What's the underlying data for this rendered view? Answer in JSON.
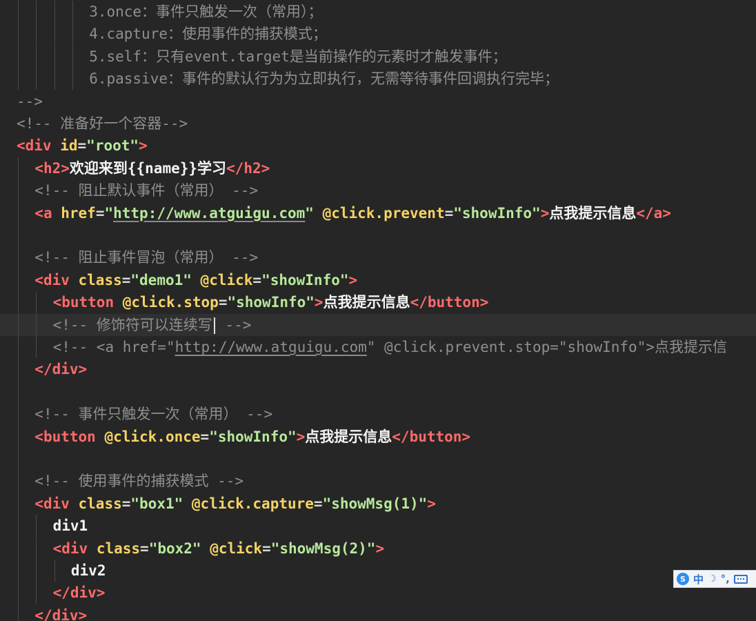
{
  "editor": {
    "lines": [
      {
        "indent": 4,
        "segments": [
          {
            "t": "comment",
            "v": "3.once：事件只触发一次（常用）；"
          }
        ]
      },
      {
        "indent": 4,
        "segments": [
          {
            "t": "comment",
            "v": "4.capture：使用事件的捕获模式；"
          }
        ]
      },
      {
        "indent": 4,
        "segments": [
          {
            "t": "comment",
            "v": "5.self：只有event.target是当前操作的元素时才触发事件；"
          }
        ]
      },
      {
        "indent": 4,
        "segments": [
          {
            "t": "comment",
            "v": "6.passive：事件的默认行为为立即执行，无需等待事件回调执行完毕；"
          }
        ]
      },
      {
        "indent": 0,
        "segments": [
          {
            "t": "comment",
            "v": "-->"
          }
        ]
      },
      {
        "indent": 0,
        "segments": [
          {
            "t": "comment",
            "v": "<!-- 准备好一个容器-->"
          }
        ]
      },
      {
        "indent": 0,
        "segments": [
          {
            "t": "tag",
            "v": "<div "
          },
          {
            "t": "attr",
            "v": "id"
          },
          {
            "t": "op",
            "v": "="
          },
          {
            "t": "str",
            "v": "\"root\""
          },
          {
            "t": "tag",
            "v": ">"
          }
        ]
      },
      {
        "indent": 1,
        "segments": [
          {
            "t": "tag",
            "v": "<h2>"
          },
          {
            "t": "text",
            "v": "欢迎来到{{name}}学习"
          },
          {
            "t": "tag",
            "v": "</h2>"
          }
        ]
      },
      {
        "indent": 1,
        "segments": [
          {
            "t": "comment",
            "v": "<!-- 阻止默认事件（常用） -->"
          }
        ]
      },
      {
        "indent": 1,
        "segments": [
          {
            "t": "tag",
            "v": "<a "
          },
          {
            "t": "attr",
            "v": "href"
          },
          {
            "t": "op",
            "v": "="
          },
          {
            "t": "str",
            "v": "\""
          },
          {
            "t": "str",
            "v": "http://www.atguigu.com",
            "link": true
          },
          {
            "t": "str",
            "v": "\" "
          },
          {
            "t": "attr",
            "v": "@click.prevent"
          },
          {
            "t": "op",
            "v": "="
          },
          {
            "t": "str",
            "v": "\"showInfo\""
          },
          {
            "t": "tag",
            "v": ">"
          },
          {
            "t": "text",
            "v": "点我提示信息"
          },
          {
            "t": "tag",
            "v": "</a>"
          }
        ]
      },
      {
        "indent": 1,
        "segments": []
      },
      {
        "indent": 1,
        "segments": [
          {
            "t": "comment",
            "v": "<!-- 阻止事件冒泡（常用） -->"
          }
        ]
      },
      {
        "indent": 1,
        "segments": [
          {
            "t": "tag",
            "v": "<div "
          },
          {
            "t": "attr",
            "v": "class"
          },
          {
            "t": "op",
            "v": "="
          },
          {
            "t": "str",
            "v": "\"demo1\" "
          },
          {
            "t": "attr",
            "v": "@click"
          },
          {
            "t": "op",
            "v": "="
          },
          {
            "t": "str",
            "v": "\"showInfo\""
          },
          {
            "t": "tag",
            "v": ">"
          }
        ]
      },
      {
        "indent": 2,
        "segments": [
          {
            "t": "tag",
            "v": "<button "
          },
          {
            "t": "attr",
            "v": "@click.stop"
          },
          {
            "t": "op",
            "v": "="
          },
          {
            "t": "str",
            "v": "\"showInfo\""
          },
          {
            "t": "tag",
            "v": ">"
          },
          {
            "t": "text",
            "v": "点我提示信息"
          },
          {
            "t": "tag",
            "v": "</button>"
          }
        ]
      },
      {
        "indent": 2,
        "current": true,
        "segments": [
          {
            "t": "comment",
            "v": "<!-- 修饰符可以连续写"
          },
          {
            "t": "cursor",
            "v": ""
          },
          {
            "t": "comment",
            "v": " -->"
          }
        ]
      },
      {
        "indent": 2,
        "segments": [
          {
            "t": "comment",
            "v": "<!-- <a href=\""
          },
          {
            "t": "comment",
            "v": "http://www.atguigu.com",
            "link": true
          },
          {
            "t": "comment",
            "v": "\" @click.prevent.stop=\"showInfo\">点我提示信"
          }
        ]
      },
      {
        "indent": 1,
        "segments": [
          {
            "t": "tag",
            "v": "</div>"
          }
        ]
      },
      {
        "indent": 1,
        "segments": []
      },
      {
        "indent": 1,
        "segments": [
          {
            "t": "comment",
            "v": "<!-- 事件只触发一次（常用） -->"
          }
        ]
      },
      {
        "indent": 1,
        "segments": [
          {
            "t": "tag",
            "v": "<button "
          },
          {
            "t": "attr",
            "v": "@click.once"
          },
          {
            "t": "op",
            "v": "="
          },
          {
            "t": "str",
            "v": "\"showInfo\""
          },
          {
            "t": "tag",
            "v": ">"
          },
          {
            "t": "text",
            "v": "点我提示信息"
          },
          {
            "t": "tag",
            "v": "</button>"
          }
        ]
      },
      {
        "indent": 1,
        "segments": []
      },
      {
        "indent": 1,
        "segments": [
          {
            "t": "comment",
            "v": "<!-- 使用事件的捕获模式 -->"
          }
        ]
      },
      {
        "indent": 1,
        "segments": [
          {
            "t": "tag",
            "v": "<div "
          },
          {
            "t": "attr",
            "v": "class"
          },
          {
            "t": "op",
            "v": "="
          },
          {
            "t": "str",
            "v": "\"box1\" "
          },
          {
            "t": "attr",
            "v": "@click.capture"
          },
          {
            "t": "op",
            "v": "="
          },
          {
            "t": "str",
            "v": "\"showMsg(1)\""
          },
          {
            "t": "tag",
            "v": ">"
          }
        ]
      },
      {
        "indent": 2,
        "segments": [
          {
            "t": "text",
            "v": "div1"
          }
        ]
      },
      {
        "indent": 2,
        "segments": [
          {
            "t": "tag",
            "v": "<div "
          },
          {
            "t": "attr",
            "v": "class"
          },
          {
            "t": "op",
            "v": "="
          },
          {
            "t": "str",
            "v": "\"box2\" "
          },
          {
            "t": "attr",
            "v": "@click"
          },
          {
            "t": "op",
            "v": "="
          },
          {
            "t": "str",
            "v": "\"showMsg(2)\""
          },
          {
            "t": "tag",
            "v": ">"
          }
        ]
      },
      {
        "indent": 3,
        "segments": [
          {
            "t": "text",
            "v": "div2"
          }
        ]
      },
      {
        "indent": 2,
        "segments": [
          {
            "t": "tag",
            "v": "</div>"
          }
        ]
      },
      {
        "indent": 1,
        "segments": [
          {
            "t": "tag",
            "v": "</div>"
          }
        ]
      }
    ]
  },
  "ime": {
    "mode_label": "中",
    "logo_icon": "sogou-logo-icon",
    "moon_icon": "half-width-moon-icon",
    "punct_icon": "punctuation-icon",
    "keyboard_icon": "keyboard-icon",
    "logo_text": "S",
    "moon_text": "☽",
    "punct_text": "°,"
  },
  "colors": {
    "background": "#262626",
    "tag": "#ff6a6a",
    "attribute": "#f6d365",
    "string": "#b7e99a",
    "comment": "#8f8f8f"
  }
}
